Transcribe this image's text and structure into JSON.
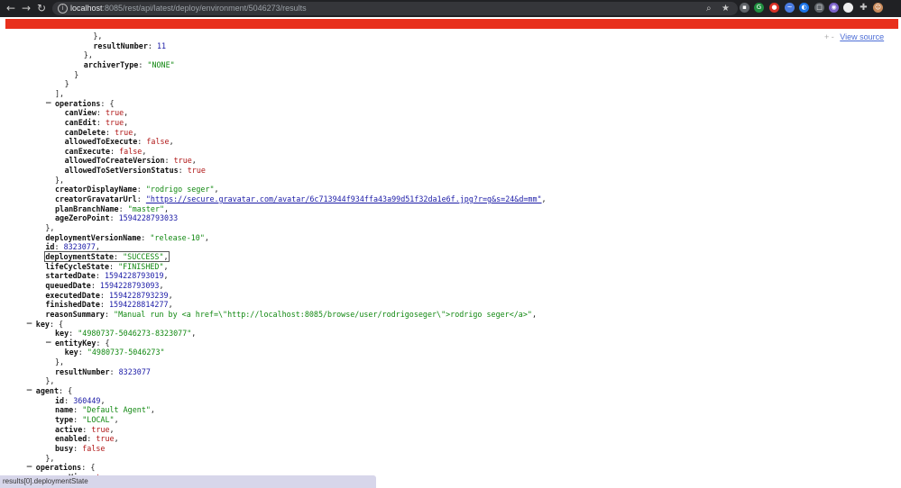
{
  "browser": {
    "url_host": "localhost",
    "url_rest": ":8085/rest/api/latest/deploy/environment/5046273/results",
    "back_glyph": "←",
    "forward_glyph": "→",
    "reload_glyph": "↻",
    "icons": [
      "search-icon",
      "star-icon",
      "extension-icons",
      "profile-avatar"
    ]
  },
  "viewer": {
    "collapse_glyph": "+ -",
    "view_source_label": "View source"
  },
  "lines": [
    {
      "indent": 18,
      "text": "},"
    },
    {
      "indent": 18,
      "key": "resultNumber",
      "val": "11",
      "vt": "n",
      "tail": ""
    },
    {
      "indent": 16,
      "text": "},"
    },
    {
      "indent": 16,
      "key": "archiverType",
      "val": "\"NONE\"",
      "vt": "s",
      "tail": ""
    },
    {
      "indent": 14,
      "text": "}"
    },
    {
      "indent": 12,
      "text": "}"
    },
    {
      "indent": 10,
      "text": "],"
    },
    {
      "indent": 10,
      "toggle": true,
      "key": "operations",
      "val": "{",
      "vt": "p",
      "tail": ""
    },
    {
      "indent": 12,
      "key": "canView",
      "val": "true",
      "vt": "b",
      "tail": ","
    },
    {
      "indent": 12,
      "key": "canEdit",
      "val": "true",
      "vt": "b",
      "tail": ","
    },
    {
      "indent": 12,
      "key": "canDelete",
      "val": "true",
      "vt": "b",
      "tail": ","
    },
    {
      "indent": 12,
      "key": "allowedToExecute",
      "val": "false",
      "vt": "b",
      "tail": ","
    },
    {
      "indent": 12,
      "key": "canExecute",
      "val": "false",
      "vt": "b",
      "tail": ","
    },
    {
      "indent": 12,
      "key": "allowedToCreateVersion",
      "val": "true",
      "vt": "b",
      "tail": ","
    },
    {
      "indent": 12,
      "key": "allowedToSetVersionStatus",
      "val": "true",
      "vt": "b",
      "tail": ""
    },
    {
      "indent": 10,
      "text": "},"
    },
    {
      "indent": 10,
      "key": "creatorDisplayName",
      "val": "\"rodrigo seger\"",
      "vt": "s",
      "tail": ","
    },
    {
      "indent": 10,
      "key": "creatorGravatarUrl",
      "val": "\"https://secure.gravatar.com/avatar/6c713944f934ffa43a99d51f32da1e6f.jpg?r=g&s=24&d=mm\"",
      "vt": "u",
      "tail": ","
    },
    {
      "indent": 10,
      "key": "planBranchName",
      "val": "\"master\"",
      "vt": "s",
      "tail": ","
    },
    {
      "indent": 10,
      "key": "ageZeroPoint",
      "val": "1594228793033",
      "vt": "n",
      "tail": ""
    },
    {
      "indent": 8,
      "text": "},"
    },
    {
      "indent": 8,
      "key": "deploymentVersionName",
      "val": "\"release-10\"",
      "vt": "s",
      "tail": ","
    },
    {
      "indent": 8,
      "key": "id",
      "val": "8323077",
      "vt": "n",
      "tail": ","
    },
    {
      "indent": 8,
      "key": "deploymentState",
      "val": "\"SUCCESS\"",
      "vt": "s",
      "tail": ",",
      "selected": true
    },
    {
      "indent": 8,
      "key": "lifeCycleState",
      "val": "\"FINISHED\"",
      "vt": "s",
      "tail": ","
    },
    {
      "indent": 8,
      "key": "startedDate",
      "val": "1594228793019",
      "vt": "n",
      "tail": ","
    },
    {
      "indent": 8,
      "key": "queuedDate",
      "val": "1594228793093",
      "vt": "n",
      "tail": ","
    },
    {
      "indent": 8,
      "key": "executedDate",
      "val": "1594228793239",
      "vt": "n",
      "tail": ","
    },
    {
      "indent": 8,
      "key": "finishedDate",
      "val": "1594228814277",
      "vt": "n",
      "tail": ","
    },
    {
      "indent": 8,
      "key": "reasonSummary",
      "val": "\"Manual run by <a href=\\\"http://localhost:8085/browse/user/rodrigoseger\\\">rodrigo seger</a>\"",
      "vt": "s",
      "tail": ","
    },
    {
      "indent": 6,
      "toggle": true,
      "key": "key",
      "val": "{",
      "vt": "p",
      "tail": ""
    },
    {
      "indent": 10,
      "key": "key",
      "val": "\"4980737-5046273-8323077\"",
      "vt": "s",
      "tail": ","
    },
    {
      "indent": 10,
      "toggle": true,
      "key": "entityKey",
      "val": "{",
      "vt": "p",
      "tail": ""
    },
    {
      "indent": 12,
      "key": "key",
      "val": "\"4980737-5046273\"",
      "vt": "s",
      "tail": ""
    },
    {
      "indent": 10,
      "text": "},"
    },
    {
      "indent": 10,
      "key": "resultNumber",
      "val": "8323077",
      "vt": "n",
      "tail": ""
    },
    {
      "indent": 8,
      "text": "},"
    },
    {
      "indent": 6,
      "toggle": true,
      "key": "agent",
      "val": "{",
      "vt": "p",
      "tail": ""
    },
    {
      "indent": 10,
      "key": "id",
      "val": "360449",
      "vt": "n",
      "tail": ","
    },
    {
      "indent": 10,
      "key": "name",
      "val": "\"Default Agent\"",
      "vt": "s",
      "tail": ","
    },
    {
      "indent": 10,
      "key": "type",
      "val": "\"LOCAL\"",
      "vt": "s",
      "tail": ","
    },
    {
      "indent": 10,
      "key": "active",
      "val": "true",
      "vt": "b",
      "tail": ","
    },
    {
      "indent": 10,
      "key": "enabled",
      "val": "true",
      "vt": "b",
      "tail": ","
    },
    {
      "indent": 10,
      "key": "busy",
      "val": "false",
      "vt": "b",
      "tail": ""
    },
    {
      "indent": 8,
      "text": "},"
    },
    {
      "indent": 6,
      "toggle": true,
      "key": "operations",
      "val": "{",
      "vt": "p",
      "tail": ""
    },
    {
      "indent": 10,
      "key": "canView",
      "val": "true",
      "vt": "b",
      "tail": ","
    }
  ],
  "status_bar": {
    "text": "results[0].deploymentState"
  },
  "colors": {
    "string": "#118811",
    "number": "#1a1aa6",
    "boolean": "#b01616",
    "error_bar": "#e8301c"
  }
}
